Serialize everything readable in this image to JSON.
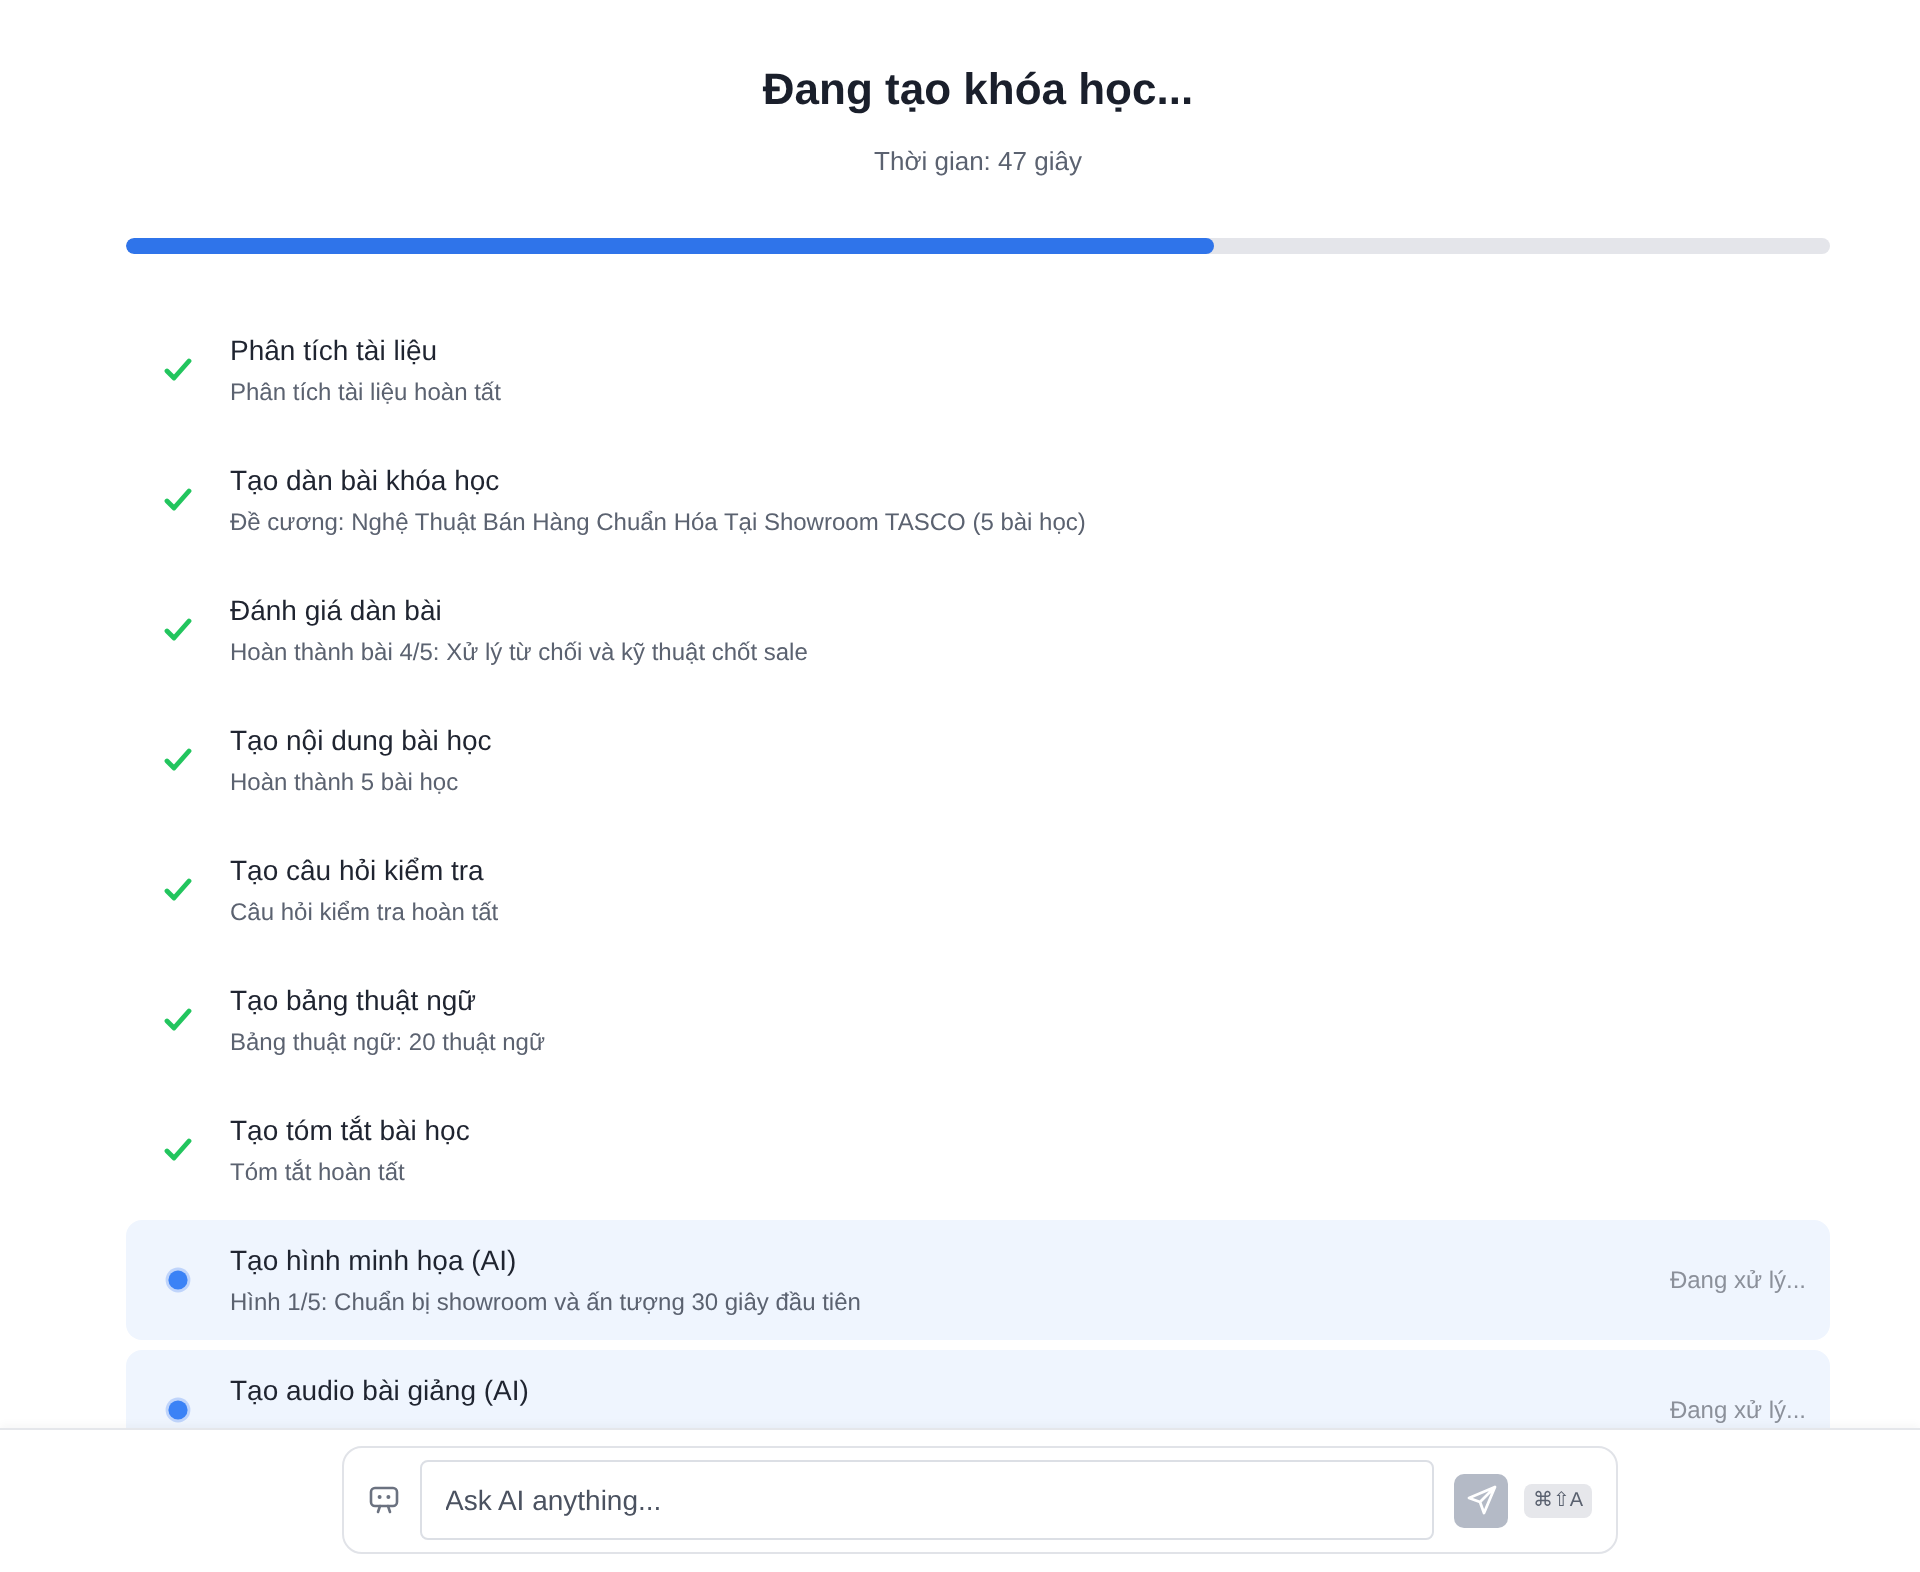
{
  "header": {
    "title": "Đang tạo khóa học...",
    "elapsed": "Thời gian: 47 giây"
  },
  "progress": {
    "level": 0.638
  },
  "steps": [
    {
      "kind": "done",
      "title": "Phân tích tài liệu",
      "detail": "Phân tích tài liệu hoàn tất"
    },
    {
      "kind": "done",
      "title": "Tạo dàn bài khóa học",
      "detail": "Đề cương: Nghệ Thuật Bán Hàng Chuẩn Hóa Tại Showroom TASCO (5 bài học)"
    },
    {
      "kind": "done",
      "title": "Đánh giá dàn bài",
      "detail": "Hoàn thành bài 4/5: Xử lý từ chối và kỹ thuật chốt sale"
    },
    {
      "kind": "done",
      "title": "Tạo nội dung bài học",
      "detail": "Hoàn thành 5 bài học"
    },
    {
      "kind": "done",
      "title": "Tạo câu hỏi kiểm tra",
      "detail": "Câu hỏi kiểm tra hoàn tất"
    },
    {
      "kind": "done",
      "title": "Tạo bảng thuật ngữ",
      "detail": "Bảng thuật ngữ: 20 thuật ngữ"
    },
    {
      "kind": "done",
      "title": "Tạo tóm tắt bài học",
      "detail": "Tóm tắt hoàn tất"
    },
    {
      "kind": "active",
      "title": "Tạo hình minh họa (AI)",
      "detail": "Hình 1/5: Chuẩn bị showroom và ấn tượng 30 giây đầu tiên",
      "state_label": "Đang xử lý..."
    },
    {
      "kind": "active",
      "title": "Tạo audio bài giảng (AI)",
      "state_label": "Đang xử lý..."
    }
  ],
  "chat": {
    "placeholder": "Ask AI anything...",
    "shortcut": "⌘⇧A"
  }
}
